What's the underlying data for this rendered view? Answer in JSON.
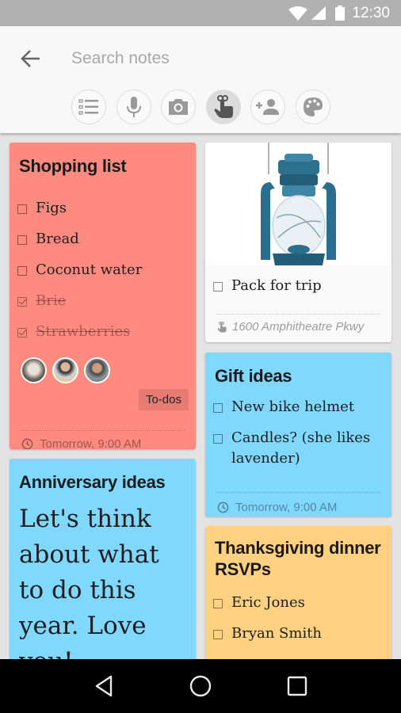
{
  "status_bar": {
    "time": "12:30",
    "icons": [
      "wifi-icon",
      "cell-signal-icon",
      "battery-icon"
    ]
  },
  "toolbar": {
    "back_icon": "arrow-back-icon",
    "search": {
      "placeholder": "Search notes",
      "value": ""
    },
    "filters": [
      {
        "name": "lists-filter",
        "icon": "checklist-icon",
        "active": false
      },
      {
        "name": "audio-filter",
        "icon": "microphone-icon",
        "active": false
      },
      {
        "name": "images-filter",
        "icon": "camera-icon",
        "active": false
      },
      {
        "name": "reminders-filter",
        "icon": "reminder-finger-icon",
        "active": true
      },
      {
        "name": "shared-filter",
        "icon": "add-person-icon",
        "active": false
      },
      {
        "name": "colors-filter",
        "icon": "palette-icon",
        "active": false
      }
    ]
  },
  "notes": {
    "shopping": {
      "title": "Shopping list",
      "color": "#ff8a80",
      "items": [
        {
          "text": "Figs",
          "checked": false
        },
        {
          "text": "Bread",
          "checked": false
        },
        {
          "text": "Coconut water",
          "checked": false
        },
        {
          "text": "Brie",
          "checked": true
        },
        {
          "text": "Strawberries",
          "checked": true
        }
      ],
      "collaborators": [
        "collaborator-1",
        "collaborator-2",
        "collaborator-3"
      ],
      "label": "To-dos",
      "reminder": "Tomorrow, 9:00 AM"
    },
    "trip": {
      "image": "lantern-image",
      "color": "#fafafa",
      "items": [
        {
          "text": "Pack for trip",
          "checked": false
        }
      ],
      "location": "1600 Amphitheatre Pkwy"
    },
    "gift": {
      "title": "Gift ideas",
      "color": "#80d8ff",
      "items": [
        {
          "text": "New bike helmet",
          "checked": false
        },
        {
          "text": "Candles? (she likes lavender)",
          "checked": false
        }
      ],
      "reminder": "Tomorrow, 9:00 AM"
    },
    "anniversary": {
      "title": "Anniversary ideas",
      "color": "#80d8ff",
      "body": "Let's think about what to do this year. Love you!"
    },
    "thanksgiving": {
      "title": "Thanksgiving dinner RSVPs",
      "color": "#ffd180",
      "items": [
        {
          "text": "Eric Jones",
          "checked": false
        },
        {
          "text": "Bryan Smith",
          "checked": false
        }
      ]
    }
  },
  "nav_bar": {
    "buttons": [
      "back-nav",
      "home-nav",
      "recents-nav"
    ]
  }
}
